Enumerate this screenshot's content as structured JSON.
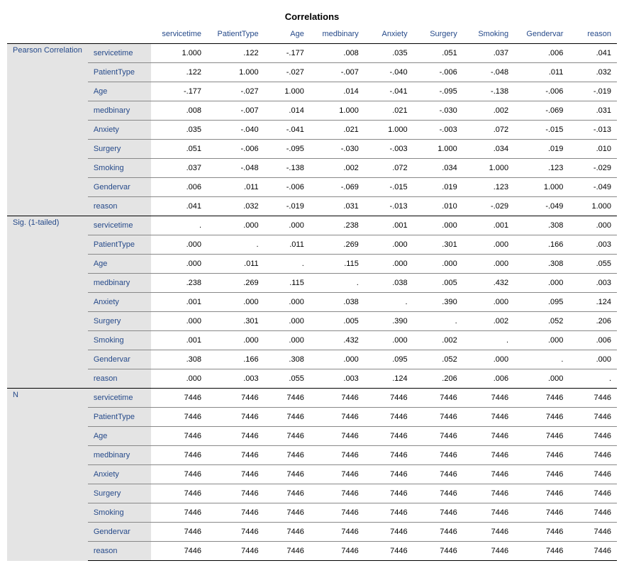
{
  "title": "Correlations",
  "variables": [
    "servicetime",
    "PatientType",
    "Age",
    "medbinary",
    "Anxiety",
    "Surgery",
    "Smoking",
    "Gendervar",
    "reason"
  ],
  "sections": [
    {
      "label": "Pearson Correlation",
      "rows": [
        {
          "var": "servicetime",
          "vals": [
            "1.000",
            ".122",
            "-.177",
            ".008",
            ".035",
            ".051",
            ".037",
            ".006",
            ".041"
          ]
        },
        {
          "var": "PatientType",
          "vals": [
            ".122",
            "1.000",
            "-.027",
            "-.007",
            "-.040",
            "-.006",
            "-.048",
            ".011",
            ".032"
          ]
        },
        {
          "var": "Age",
          "vals": [
            "-.177",
            "-.027",
            "1.000",
            ".014",
            "-.041",
            "-.095",
            "-.138",
            "-.006",
            "-.019"
          ]
        },
        {
          "var": "medbinary",
          "vals": [
            ".008",
            "-.007",
            ".014",
            "1.000",
            ".021",
            "-.030",
            ".002",
            "-.069",
            ".031"
          ]
        },
        {
          "var": "Anxiety",
          "vals": [
            ".035",
            "-.040",
            "-.041",
            ".021",
            "1.000",
            "-.003",
            ".072",
            "-.015",
            "-.013"
          ]
        },
        {
          "var": "Surgery",
          "vals": [
            ".051",
            "-.006",
            "-.095",
            "-.030",
            "-.003",
            "1.000",
            ".034",
            ".019",
            ".010"
          ]
        },
        {
          "var": "Smoking",
          "vals": [
            ".037",
            "-.048",
            "-.138",
            ".002",
            ".072",
            ".034",
            "1.000",
            ".123",
            "-.029"
          ]
        },
        {
          "var": "Gendervar",
          "vals": [
            ".006",
            ".011",
            "-.006",
            "-.069",
            "-.015",
            ".019",
            ".123",
            "1.000",
            "-.049"
          ]
        },
        {
          "var": "reason",
          "vals": [
            ".041",
            ".032",
            "-.019",
            ".031",
            "-.013",
            ".010",
            "-.029",
            "-.049",
            "1.000"
          ]
        }
      ]
    },
    {
      "label": "Sig. (1-tailed)",
      "rows": [
        {
          "var": "servicetime",
          "vals": [
            ".",
            ".000",
            ".000",
            ".238",
            ".001",
            ".000",
            ".001",
            ".308",
            ".000"
          ]
        },
        {
          "var": "PatientType",
          "vals": [
            ".000",
            ".",
            ".011",
            ".269",
            ".000",
            ".301",
            ".000",
            ".166",
            ".003"
          ]
        },
        {
          "var": "Age",
          "vals": [
            ".000",
            ".011",
            ".",
            ".115",
            ".000",
            ".000",
            ".000",
            ".308",
            ".055"
          ]
        },
        {
          "var": "medbinary",
          "vals": [
            ".238",
            ".269",
            ".115",
            ".",
            ".038",
            ".005",
            ".432",
            ".000",
            ".003"
          ]
        },
        {
          "var": "Anxiety",
          "vals": [
            ".001",
            ".000",
            ".000",
            ".038",
            ".",
            ".390",
            ".000",
            ".095",
            ".124"
          ]
        },
        {
          "var": "Surgery",
          "vals": [
            ".000",
            ".301",
            ".000",
            ".005",
            ".390",
            ".",
            ".002",
            ".052",
            ".206"
          ]
        },
        {
          "var": "Smoking",
          "vals": [
            ".001",
            ".000",
            ".000",
            ".432",
            ".000",
            ".002",
            ".",
            ".000",
            ".006"
          ]
        },
        {
          "var": "Gendervar",
          "vals": [
            ".308",
            ".166",
            ".308",
            ".000",
            ".095",
            ".052",
            ".000",
            ".",
            ".000"
          ]
        },
        {
          "var": "reason",
          "vals": [
            ".000",
            ".003",
            ".055",
            ".003",
            ".124",
            ".206",
            ".006",
            ".000",
            "."
          ]
        }
      ]
    },
    {
      "label": "N",
      "rows": [
        {
          "var": "servicetime",
          "vals": [
            "7446",
            "7446",
            "7446",
            "7446",
            "7446",
            "7446",
            "7446",
            "7446",
            "7446"
          ]
        },
        {
          "var": "PatientType",
          "vals": [
            "7446",
            "7446",
            "7446",
            "7446",
            "7446",
            "7446",
            "7446",
            "7446",
            "7446"
          ]
        },
        {
          "var": "Age",
          "vals": [
            "7446",
            "7446",
            "7446",
            "7446",
            "7446",
            "7446",
            "7446",
            "7446",
            "7446"
          ]
        },
        {
          "var": "medbinary",
          "vals": [
            "7446",
            "7446",
            "7446",
            "7446",
            "7446",
            "7446",
            "7446",
            "7446",
            "7446"
          ]
        },
        {
          "var": "Anxiety",
          "vals": [
            "7446",
            "7446",
            "7446",
            "7446",
            "7446",
            "7446",
            "7446",
            "7446",
            "7446"
          ]
        },
        {
          "var": "Surgery",
          "vals": [
            "7446",
            "7446",
            "7446",
            "7446",
            "7446",
            "7446",
            "7446",
            "7446",
            "7446"
          ]
        },
        {
          "var": "Smoking",
          "vals": [
            "7446",
            "7446",
            "7446",
            "7446",
            "7446",
            "7446",
            "7446",
            "7446",
            "7446"
          ]
        },
        {
          "var": "Gendervar",
          "vals": [
            "7446",
            "7446",
            "7446",
            "7446",
            "7446",
            "7446",
            "7446",
            "7446",
            "7446"
          ]
        },
        {
          "var": "reason",
          "vals": [
            "7446",
            "7446",
            "7446",
            "7446",
            "7446",
            "7446",
            "7446",
            "7446",
            "7446"
          ]
        }
      ]
    }
  ]
}
